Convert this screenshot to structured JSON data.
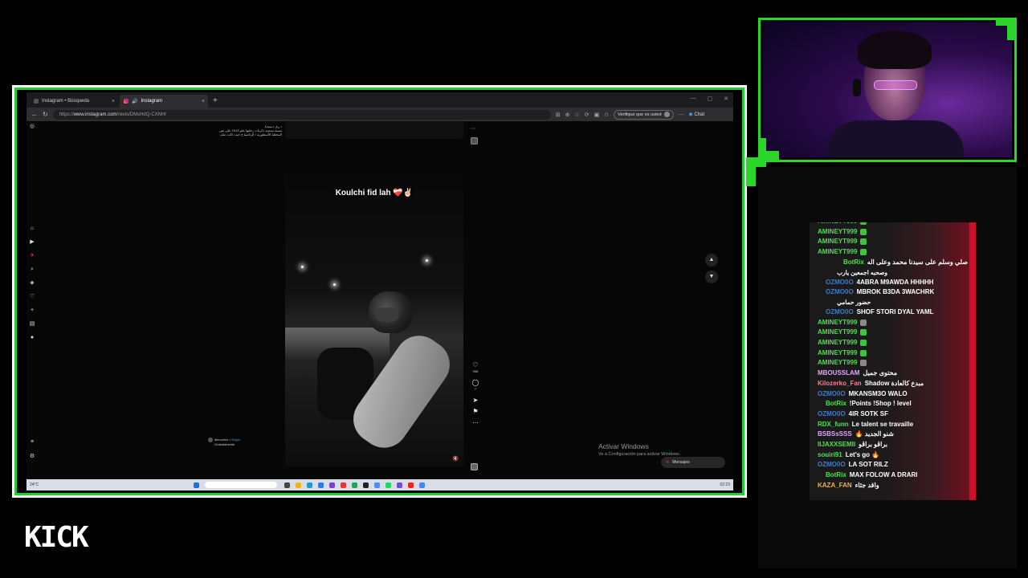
{
  "browser": {
    "tabs": [
      {
        "label": "Instagram • Búsqueda",
        "close": "×"
      },
      {
        "label": "Instagram",
        "close": "×"
      }
    ],
    "new_tab": "+",
    "url_scheme": "https://",
    "url_host": "www.instagram.com",
    "url_path": "/reels/DMsHdQ-CXNH/",
    "verify_label": "Verifique que es usted",
    "copilot_label": "Chat"
  },
  "instagram": {
    "caption_lines": [
      "• ريل • سيدنا",
      "مسنة تسجيد ذكريات رخلتها علم 1913 على متن",
      "المحطة الأسطورية • الرئاسيا ح حيث كانت تقف"
    ],
    "reel_caption": "Koulchi fid lah ❤️‍🩹✌🏻",
    "like_count": "956",
    "comment_count": "7",
    "author_name": "aimooridz",
    "author_follow": "Seguir",
    "author_sub": "Gratuitamente",
    "mute_icon": "🔇"
  },
  "windows": {
    "activate_title": "Activar Windows",
    "activate_sub": "Ve a Configuración para activar Windows.",
    "messages_label": "Mensajes",
    "weather": "24°C",
    "clock": "02:23"
  },
  "chat": {
    "messages": [
      {
        "user": "AMINEYT999",
        "color": "#49e34a",
        "text": "",
        "emote": "green",
        "indent": 0
      },
      {
        "user": "AMINEYT999",
        "color": "#49e34a",
        "text": "",
        "emote": "green",
        "indent": 0
      },
      {
        "user": "AMINEYT999",
        "color": "#49e34a",
        "text": "",
        "emote": "green",
        "indent": 0
      },
      {
        "user": "AMINEYT999",
        "color": "#49e34a",
        "text": "",
        "emote": "green",
        "indent": 0
      },
      {
        "user": "BotRix",
        "color": "#49e34a",
        "text": "اللهم صلي وسلم على سيدنا محمد وعلى اله",
        "emote": "",
        "indent": 2,
        "rtl": true,
        "cont": "وصحبه اجمعين يارب"
      },
      {
        "user": "OZMO0O",
        "color": "#3a7bd5",
        "text": "4ABRA M9AWDA HHHHH",
        "emote": "",
        "indent": 1
      },
      {
        "user": "OZMO0O",
        "color": "#3a7bd5",
        "text": "MBROK B3DA 3WACHRK",
        "emote": "",
        "indent": 1,
        "cont": "حضور حمامي"
      },
      {
        "user": "OZMO0O",
        "color": "#3a7bd5",
        "text": "SHOF STORI DYAL YAML",
        "emote": "",
        "indent": 1
      },
      {
        "user": "AMINEYT999",
        "color": "#49e34a",
        "text": "",
        "emote": "gray",
        "indent": 0
      },
      {
        "user": "AMINEYT999",
        "color": "#49e34a",
        "text": "",
        "emote": "green",
        "indent": 0
      },
      {
        "user": "AMINEYT999",
        "color": "#49e34a",
        "text": "",
        "emote": "green",
        "indent": 0
      },
      {
        "user": "AMINEYT999",
        "color": "#49e34a",
        "text": "",
        "emote": "green",
        "indent": 0
      },
      {
        "user": "AMINEYT999",
        "color": "#49e34a",
        "text": "",
        "emote": "gray",
        "indent": 0
      },
      {
        "user": "MBOUSSLAM",
        "color": "#e8a0ff",
        "text": "محتوى جميل",
        "emote": "",
        "indent": 0,
        "rtl": true
      },
      {
        "user": "Kilozerko_Fan",
        "color": "#ff7a9a",
        "text": "Shadow مبدع كالعادة",
        "emote": "",
        "indent": 0
      },
      {
        "user": "OZMO0O",
        "color": "#3a7bd5",
        "text": "MKANSM3O WALO",
        "emote": "",
        "indent": 0
      },
      {
        "user": "BotRix",
        "color": "#49e34a",
        "text": "!Points !Shop ! level",
        "emote": "",
        "indent": 1
      },
      {
        "user": "OZMO0O",
        "color": "#3a7bd5",
        "text": "4IR SOTK SF",
        "emote": "",
        "indent": 0
      },
      {
        "user": "RDX_funn",
        "color": "#49e34a",
        "text": "Le talent se travaille",
        "emote": "",
        "indent": 0
      },
      {
        "user": "BSBSsSSS",
        "color": "#e8a0ff",
        "text": "🔥 شنو الجديد",
        "emote": "",
        "indent": 0
      },
      {
        "user": "IIJAXXSEMII",
        "color": "#49e34a",
        "text": "براڤو براڤو",
        "emote": "",
        "indent": 0
      },
      {
        "user": "souiri91",
        "color": "#49e34a",
        "text": "Let's go 🔥",
        "emote": "",
        "indent": 0
      },
      {
        "user": "OZMO0O",
        "color": "#3a7bd5",
        "text": "LA SOT RILZ",
        "emote": "",
        "indent": 0
      },
      {
        "user": "BotRix",
        "color": "#49e34a",
        "text": "MAX FOLOW A DRARI",
        "emote": "",
        "indent": 1
      },
      {
        "user": "KAZA_FAN",
        "color": "#f0b040",
        "text": "واقد جئاء",
        "emote": "",
        "indent": 0
      }
    ]
  },
  "brand": {
    "logo": "KICK"
  }
}
